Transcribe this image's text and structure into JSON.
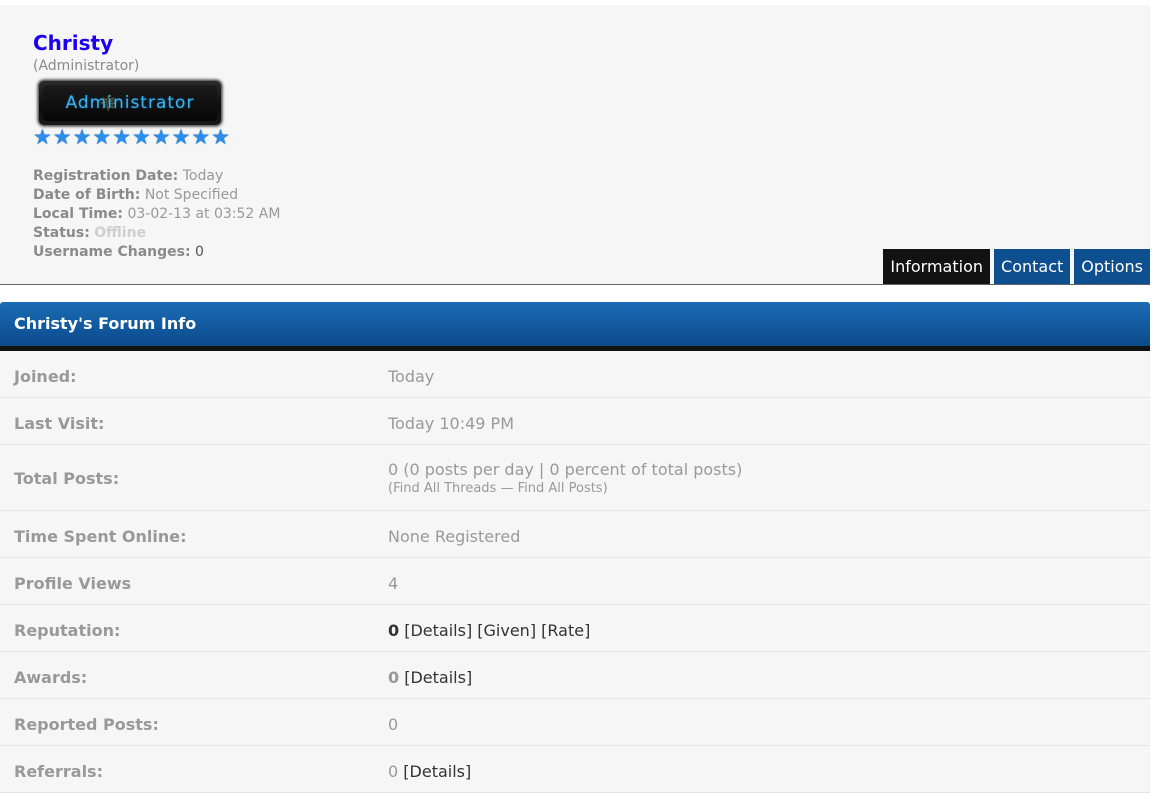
{
  "profile": {
    "username": "Christy",
    "usertitle": "(Administrator)",
    "group_badge": "Administrator",
    "stars": [
      "★",
      "★",
      "★",
      "★",
      "★",
      "★",
      "★",
      "★",
      "★",
      "★"
    ],
    "details": {
      "registration_label": "Registration Date:",
      "registration_value": "Today",
      "dob_label": "Date of Birth:",
      "dob_value": "Not Specified",
      "localtime_label": "Local Time:",
      "localtime_value": "03-02-13 at 03:52 AM",
      "status_label": "Status:",
      "status_value": "Offline",
      "username_changes_label": "Username Changes:",
      "username_changes_value": "0"
    }
  },
  "tabs": [
    "Information",
    "Contact",
    "Options"
  ],
  "forum_info": {
    "title": "Christy's Forum Info",
    "joined_label": "Joined:",
    "joined_value": "Today",
    "last_visit_label": "Last Visit:",
    "last_visit_value": "Today 10:49 PM",
    "total_posts_label": "Total Posts:",
    "total_posts_value": "0 (0 posts per day | 0 percent of total posts)",
    "find_open": "(",
    "find_threads": "Find All Threads",
    "find_sep": " — ",
    "find_posts": "Find All Posts",
    "find_close": ")",
    "time_online_label": "Time Spent Online:",
    "time_online_value": "None Registered",
    "profile_views_label": "Profile Views",
    "profile_views_value": "4",
    "reputation_label": "Reputation:",
    "reputation_value": "0",
    "reputation_links": [
      "[Details]",
      "[Given]",
      "[Rate]"
    ],
    "awards_label": "Awards:",
    "awards_value": "0",
    "awards_link": "[Details]",
    "reported_label": "Reported Posts:",
    "reported_value": "0",
    "referrals_label": "Referrals:",
    "referrals_value": "0",
    "referrals_link": "[Details]"
  }
}
